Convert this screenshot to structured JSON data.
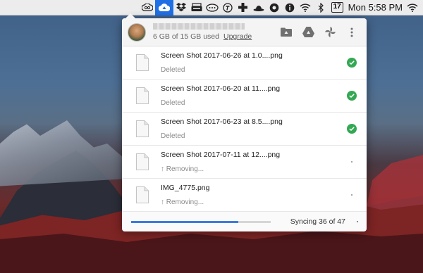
{
  "menubar": {
    "icons": [
      "creative-cloud-icon",
      "google-backup-sync-icon",
      "dropbox-icon",
      "typewriter-icon",
      "chat-bubble-icon",
      "timing-icon",
      "medical-cross-icon",
      "bowler-hat-icon",
      "vpn-icon",
      "info-icon",
      "wifi-icon",
      "bluetooth-icon"
    ],
    "calendar_day": "17",
    "clock": "Mon 5:58 PM",
    "accent_color": "#1f6fe5"
  },
  "account": {
    "storage_text": "6 GB of 15 GB used",
    "upgrade_label": "Upgrade"
  },
  "header_icons": [
    "open-folder-icon",
    "google-drive-icon",
    "google-photos-icon",
    "more-vert-icon"
  ],
  "files": [
    {
      "name": "Screen Shot 2017-06-26 at 1.0....png",
      "status": "Deleted",
      "state": "done"
    },
    {
      "name": "Screen Shot 2017-06-20 at 11....png",
      "status": "Deleted",
      "state": "done"
    },
    {
      "name": "Screen Shot 2017-06-23 at 8.5....png",
      "status": "Deleted",
      "state": "done"
    },
    {
      "name": "Screen Shot 2017-07-11 at 12....png",
      "status": "↑ Removing...",
      "state": "pending"
    },
    {
      "name": "IMG_4775.png",
      "status": "↑ Removing...",
      "state": "pending"
    }
  ],
  "sync": {
    "text": "Syncing 36 of 47",
    "progress_fraction": 0.77,
    "progress_color": "#3b7be2",
    "done_color": "#34a853"
  }
}
